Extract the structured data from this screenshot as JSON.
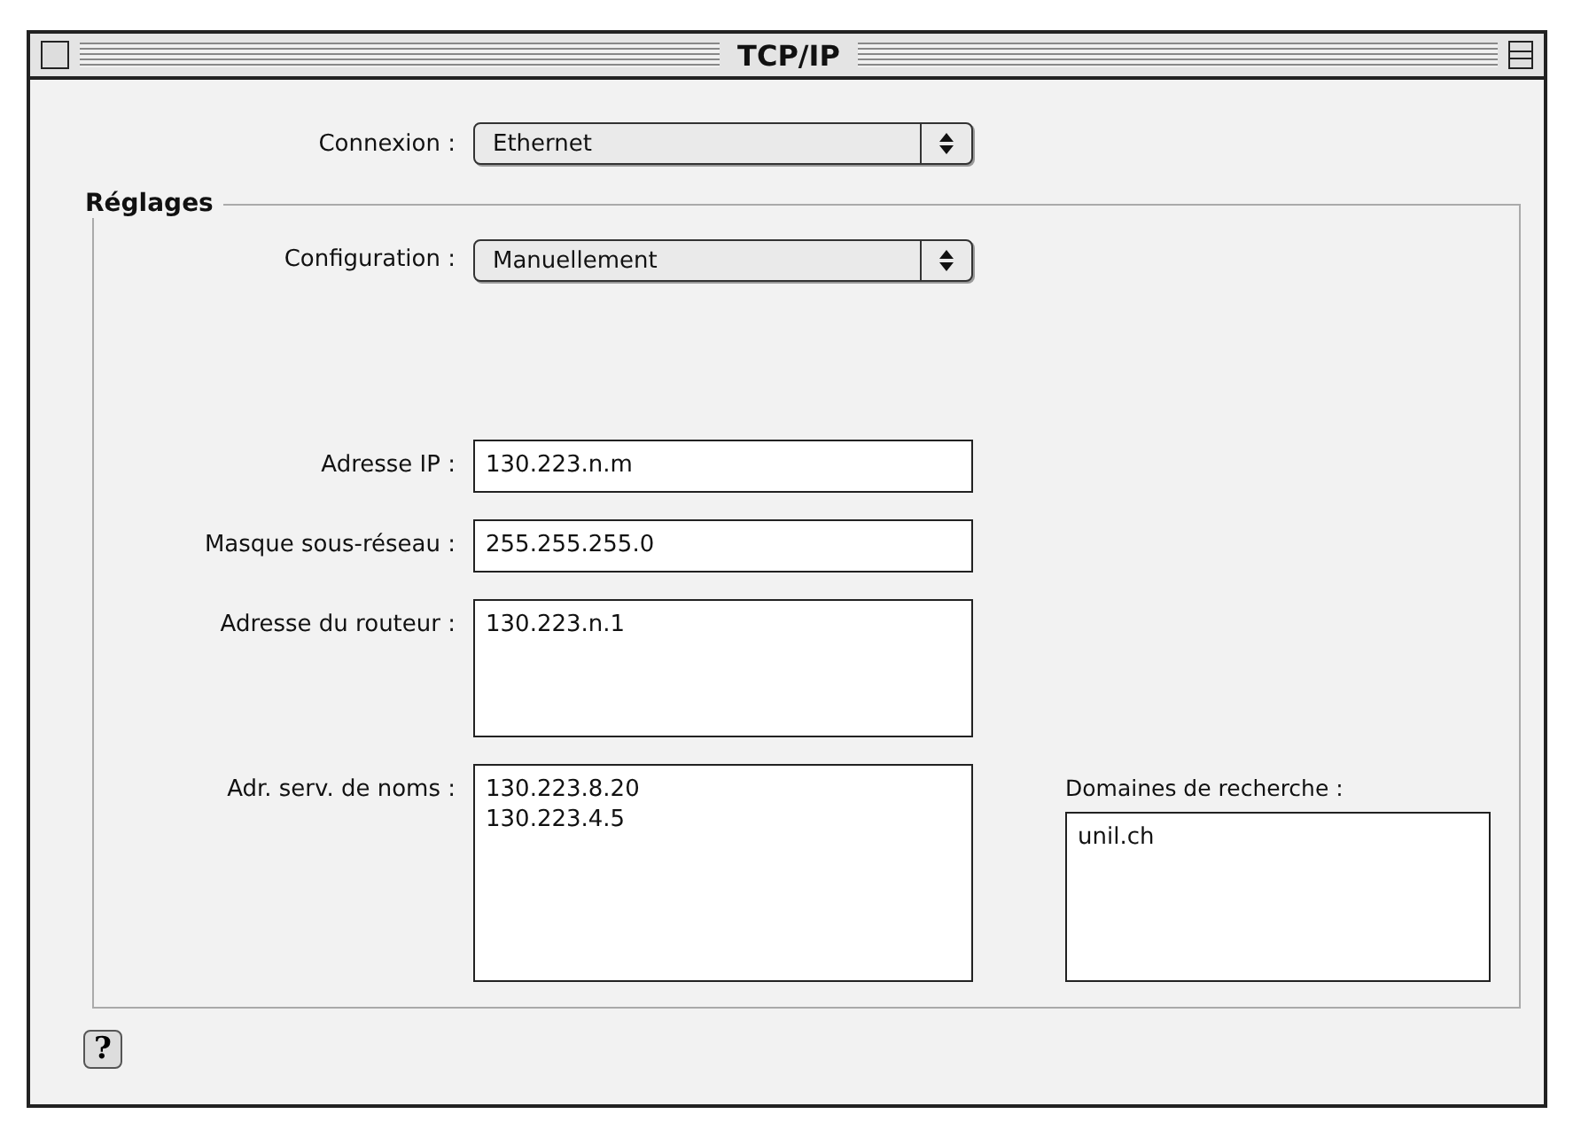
{
  "window": {
    "title": "TCP/IP"
  },
  "connection": {
    "label": "Connexion :",
    "value": "Ethernet"
  },
  "settings": {
    "title": "Réglages",
    "configuration": {
      "label": "Configuration :",
      "value": "Manuellement"
    },
    "fields": [
      {
        "label": "Adresse IP :",
        "kind": "line",
        "lines": [
          "130.223.n.m"
        ]
      },
      {
        "label": "Masque sous-réseau :",
        "kind": "line",
        "lines": [
          "255.255.255.0"
        ]
      },
      {
        "label": "Adresse du routeur :",
        "kind": "box",
        "lines": [
          "130.223.n.1"
        ]
      },
      {
        "label": "Adr. serv. de noms :",
        "kind": "tall",
        "lines": [
          "130.223.8.20",
          "130.223.4.5"
        ]
      }
    ],
    "search_domains": {
      "label": "Domaines de recherche :",
      "lines": [
        "unil.ch"
      ]
    }
  },
  "help": {
    "symbol": "?"
  }
}
